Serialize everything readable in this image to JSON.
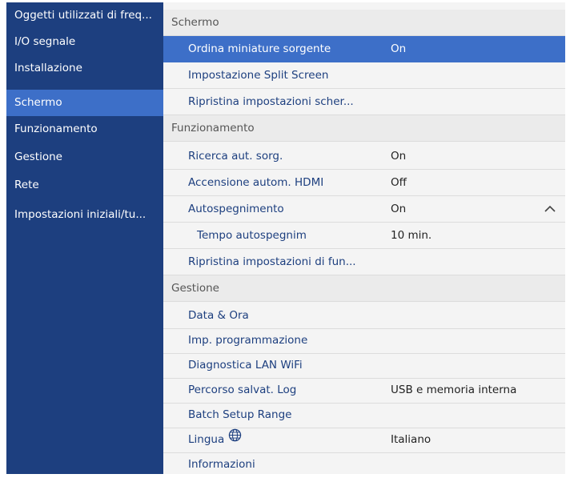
{
  "sidebar": {
    "items": [
      {
        "label": "Oggetti utilizzati di freq..."
      },
      {
        "label": "I/O segnale"
      },
      {
        "label": "Installazione"
      },
      {
        "label": "Schermo"
      },
      {
        "label": "Funzionamento"
      },
      {
        "label": "Gestione"
      },
      {
        "label": "Rete"
      },
      {
        "label": "Impostazioni iniziali/tu..."
      }
    ],
    "active": "Schermo"
  },
  "sections": {
    "schermo": {
      "title": "Schermo",
      "items": [
        {
          "label": "Ordina miniature sorgente",
          "value": "On"
        },
        {
          "label": "Impostazione Split Screen"
        },
        {
          "label": "Ripristina impostazioni scher..."
        }
      ]
    },
    "funzionamento": {
      "title": "Funzionamento",
      "items": [
        {
          "label": "Ricerca aut. sorg.",
          "value": "On"
        },
        {
          "label": "Accensione autom. HDMI",
          "value": "Off"
        },
        {
          "label": "Autospegnimento",
          "value": "On",
          "icon": "chevron-up-icon"
        },
        {
          "label": "Tempo autospegnim",
          "value": "10 min."
        },
        {
          "label": "Ripristina impostazioni di fun..."
        }
      ]
    },
    "gestione": {
      "title": "Gestione",
      "items": [
        {
          "label": "Data & Ora"
        },
        {
          "label": "Imp. programmazione"
        },
        {
          "label": "Diagnostica LAN WiFi"
        },
        {
          "label": "Percorso salvat. Log",
          "value": "USB e memoria interna"
        },
        {
          "label": "Batch Setup Range"
        },
        {
          "label": "Lingua",
          "value": "Italiano",
          "icon": "globe-icon"
        },
        {
          "label": "Informazioni"
        }
      ]
    }
  },
  "colors": {
    "sidebar_bg": "#1d3f7f",
    "accent": "#3d6fc8",
    "panel_bg": "#f4f4f4",
    "text_blue": "#1d3f7f"
  }
}
